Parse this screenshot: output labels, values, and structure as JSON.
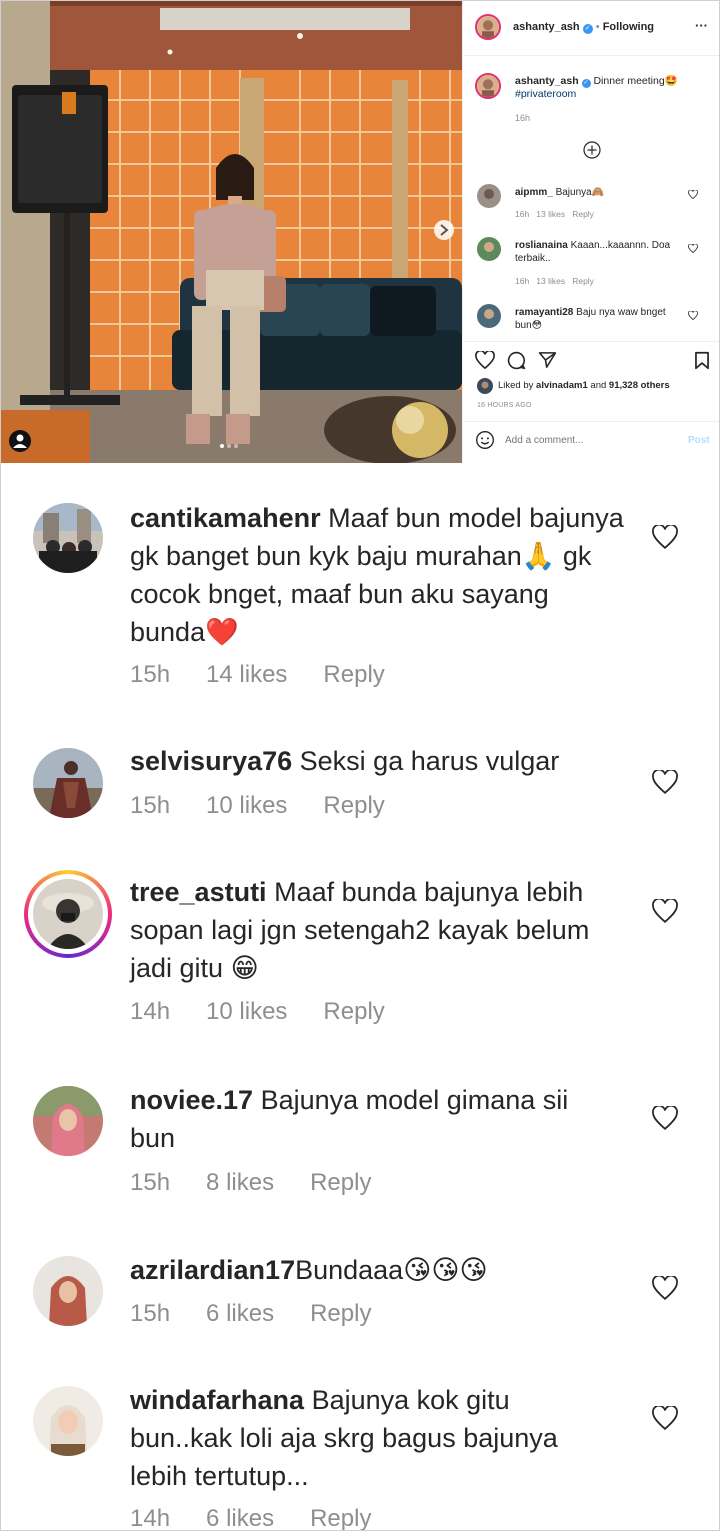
{
  "post": {
    "author": "ashanty_ash",
    "follow_status": "Following",
    "more_label": "···",
    "caption_user": "ashanty_ash",
    "caption_text": "Dinner meeting",
    "caption_emoji": "🤩",
    "caption_hashtag": "#privateroom",
    "caption_time": "16h",
    "load_more_icon": "plus-circle-icon",
    "comments": [
      {
        "user": "aipmm_",
        "text": "Bajunya🙈",
        "time": "16h",
        "likes": "13 likes",
        "reply": "Reply"
      },
      {
        "user": "roslianaina",
        "text": "Kaaan...kaaannn. Doa terbaik..",
        "time": "16h",
        "likes": "13 likes",
        "reply": "Reply"
      },
      {
        "user": "ramayanti28",
        "text": "Baju nya waw bnget bun😳",
        "time": "",
        "likes": "",
        "reply": ""
      }
    ],
    "liked_by_prefix": "Liked by",
    "liked_by_user": "alvinadam1",
    "liked_by_and": "and",
    "liked_by_count": "91,328 others",
    "timestamp": "16 HOURS AGO",
    "comment_placeholder": "Add a comment...",
    "post_button": "Post"
  },
  "comments": [
    {
      "user": "cantikamahenr",
      "text": "Maaf bun model bajunya gk banget bun kyk baju murahan🙏 gk cocok bnget, maaf bun aku sayang bunda❤️",
      "time": "15h",
      "likes": "14 likes",
      "reply": "Reply"
    },
    {
      "user": "selvisurya76",
      "text": "Seksi ga harus vulgar",
      "time": "15h",
      "likes": "10 likes",
      "reply": "Reply"
    },
    {
      "user": "tree_astuti",
      "text": "Maaf bunda bajunya lebih sopan lagi jgn setengah2 kayak belum jadi gitu 😁",
      "time": "14h",
      "likes": "10 likes",
      "reply": "Reply"
    },
    {
      "user": "noviee.17",
      "text": "Bajunya model gimana sii bun",
      "time": "15h",
      "likes": "8 likes",
      "reply": "Reply"
    },
    {
      "user": "azrilardian17",
      "text": "Bundaaa😘😘😘",
      "time": "15h",
      "likes": "6 likes",
      "reply": "Reply"
    },
    {
      "user": "windafarhana",
      "text": "Bajunya kok gitu bun..kak loli aja skrg bagus bajunya lebih tertutup...",
      "time": "14h",
      "likes": "6 likes",
      "reply": "Reply"
    }
  ],
  "colors": {
    "brand_blue": "#0095f6",
    "text": "#262626",
    "muted": "#8e8e8e",
    "link": "#00376b",
    "tile_orange": "#e8853a"
  }
}
